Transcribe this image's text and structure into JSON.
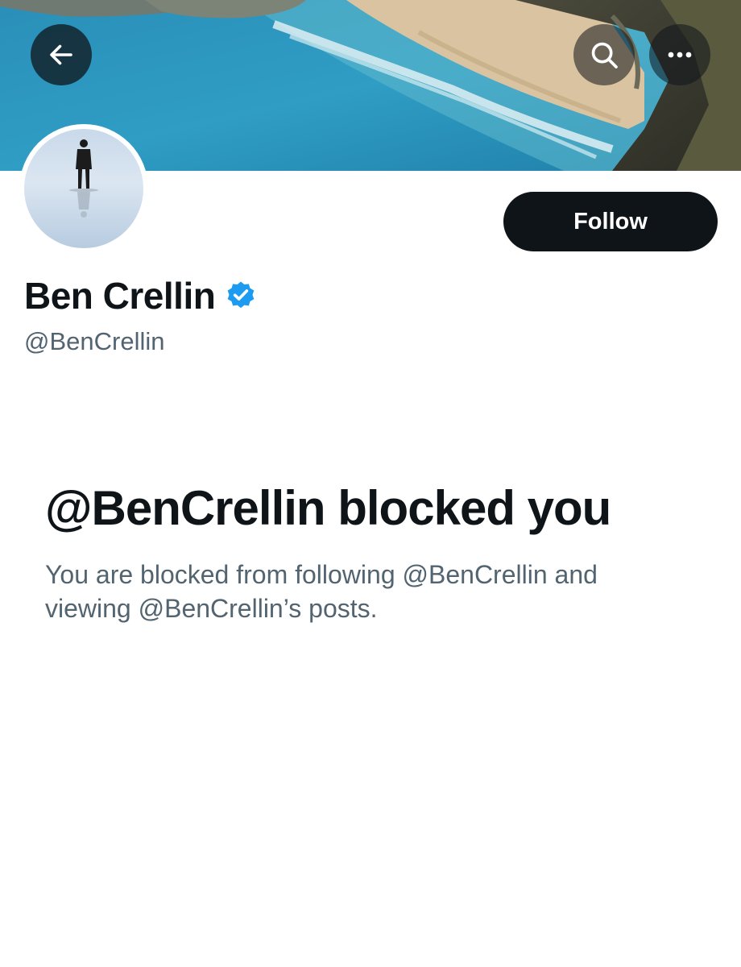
{
  "header": {
    "back_icon": "arrow-left-icon",
    "search_icon": "search-icon",
    "more_icon": "more-horizontal-icon"
  },
  "profile": {
    "display_name": "Ben Crellin",
    "handle": "@BenCrellin",
    "verified": true,
    "follow_label": "Follow"
  },
  "blocked": {
    "title": "@BenCrellin blocked you",
    "description": "You are blocked from following @BenCrellin and viewing @BenCrellin’s posts."
  },
  "colors": {
    "text_primary": "#0f1419",
    "text_secondary": "#536471",
    "verified_blue": "#1d9bf0",
    "button_dark": "#0f1419"
  }
}
